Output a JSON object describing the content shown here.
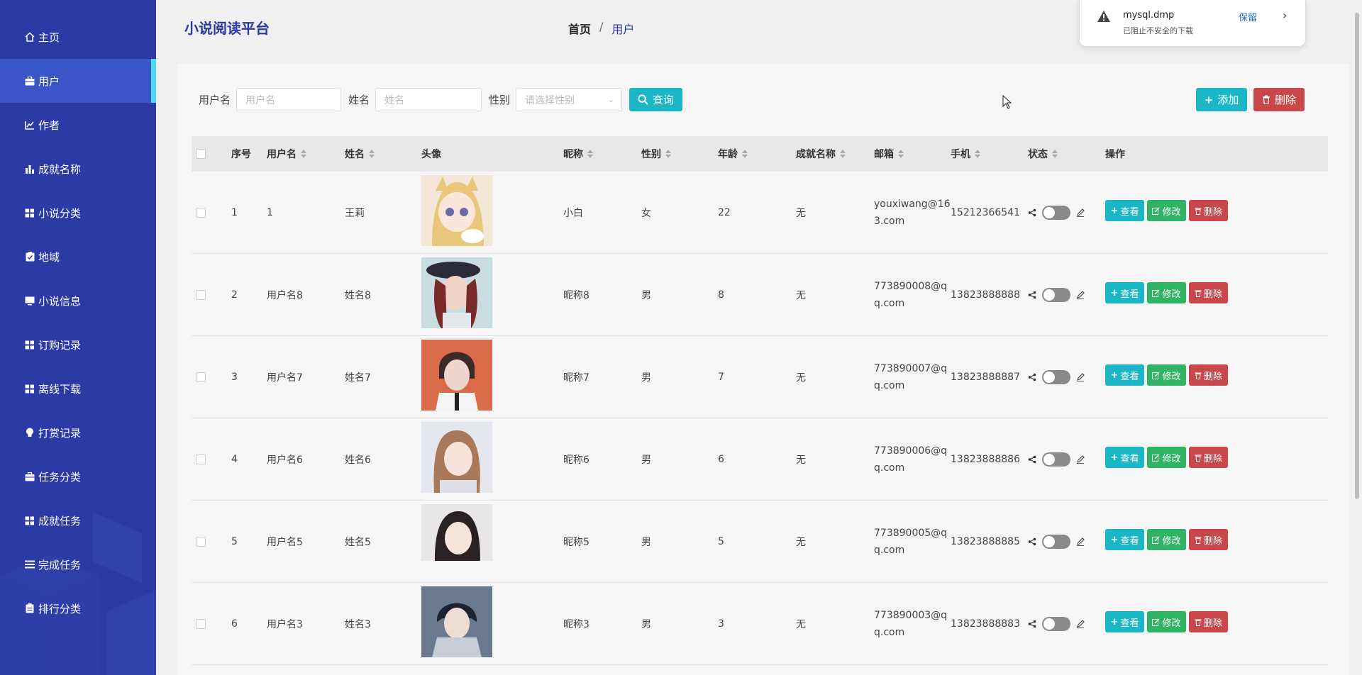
{
  "sidebar": {
    "items": [
      {
        "label": "主页",
        "icon": "home-icon"
      },
      {
        "label": "用户",
        "icon": "briefcase-icon",
        "active": true
      },
      {
        "label": "作者",
        "icon": "chart-line-icon"
      },
      {
        "label": "成就名称",
        "icon": "bar-chart-icon"
      },
      {
        "label": "小说分类",
        "icon": "grid-icon"
      },
      {
        "label": "地域",
        "icon": "clipboard-check-icon"
      },
      {
        "label": "小说信息",
        "icon": "monitor-icon"
      },
      {
        "label": "订购记录",
        "icon": "grid-icon"
      },
      {
        "label": "离线下载",
        "icon": "grid-icon"
      },
      {
        "label": "打赏记录",
        "icon": "lightbulb-icon"
      },
      {
        "label": "任务分类",
        "icon": "briefcase-icon"
      },
      {
        "label": "成就任务",
        "icon": "grid-icon"
      },
      {
        "label": "完成任务",
        "icon": "list-icon"
      },
      {
        "label": "排行分类",
        "icon": "clipboard-icon"
      }
    ]
  },
  "header": {
    "brand": "小说阅读平台",
    "breadcrumb": {
      "home": "首页",
      "sep": "/",
      "current": "用户"
    }
  },
  "download_popup": {
    "filename": "mysql.dmp",
    "status": "已阻止不安全的下载",
    "keep": "保留"
  },
  "search": {
    "username_label": "用户名",
    "username_placeholder": "用户名",
    "name_label": "姓名",
    "name_placeholder": "姓名",
    "gender_label": "性别",
    "gender_placeholder": "请选择性别",
    "query_button": "查询"
  },
  "toolbar": {
    "add": "添加",
    "delete": "删除"
  },
  "table": {
    "headers": {
      "index": "序号",
      "username": "用户名",
      "name": "姓名",
      "avatar": "头像",
      "nickname": "昵称",
      "gender": "性别",
      "age": "年龄",
      "achievement": "成就名称",
      "email": "邮箱",
      "phone": "手机",
      "status": "状态",
      "actions": "操作"
    },
    "actions": {
      "view": "查看",
      "edit": "修改",
      "delete": "删除"
    },
    "rows": [
      {
        "index": "1",
        "username": "1",
        "name": "王莉",
        "nickname": "小白",
        "gender": "女",
        "age": "22",
        "achievement": "无",
        "email": "youxiwang@163.com",
        "phone": "15212366541"
      },
      {
        "index": "2",
        "username": "用户名8",
        "name": "姓名8",
        "nickname": "昵称8",
        "gender": "男",
        "age": "8",
        "achievement": "无",
        "email": "773890008@qq.com",
        "phone": "13823888888"
      },
      {
        "index": "3",
        "username": "用户名7",
        "name": "姓名7",
        "nickname": "昵称7",
        "gender": "男",
        "age": "7",
        "achievement": "无",
        "email": "773890007@qq.com",
        "phone": "13823888887"
      },
      {
        "index": "4",
        "username": "用户名6",
        "name": "姓名6",
        "nickname": "昵称6",
        "gender": "男",
        "age": "6",
        "achievement": "无",
        "email": "773890006@qq.com",
        "phone": "13823888886"
      },
      {
        "index": "5",
        "username": "用户名5",
        "name": "姓名5",
        "nickname": "昵称5",
        "gender": "男",
        "age": "5",
        "achievement": "无",
        "email": "773890005@qq.com",
        "phone": "13823888885"
      },
      {
        "index": "6",
        "username": "用户名3",
        "name": "姓名3",
        "nickname": "昵称3",
        "gender": "男",
        "age": "3",
        "achievement": "无",
        "email": "773890003@qq.com",
        "phone": "13823888883"
      }
    ]
  },
  "colors": {
    "sidebar_bg": "#2b3aa5",
    "sidebar_active": "#3a55c7",
    "accent_bar": "#4dd9f0",
    "primary_teal": "#1bb7c6",
    "danger": "#c9474a",
    "success": "#2fb463"
  }
}
